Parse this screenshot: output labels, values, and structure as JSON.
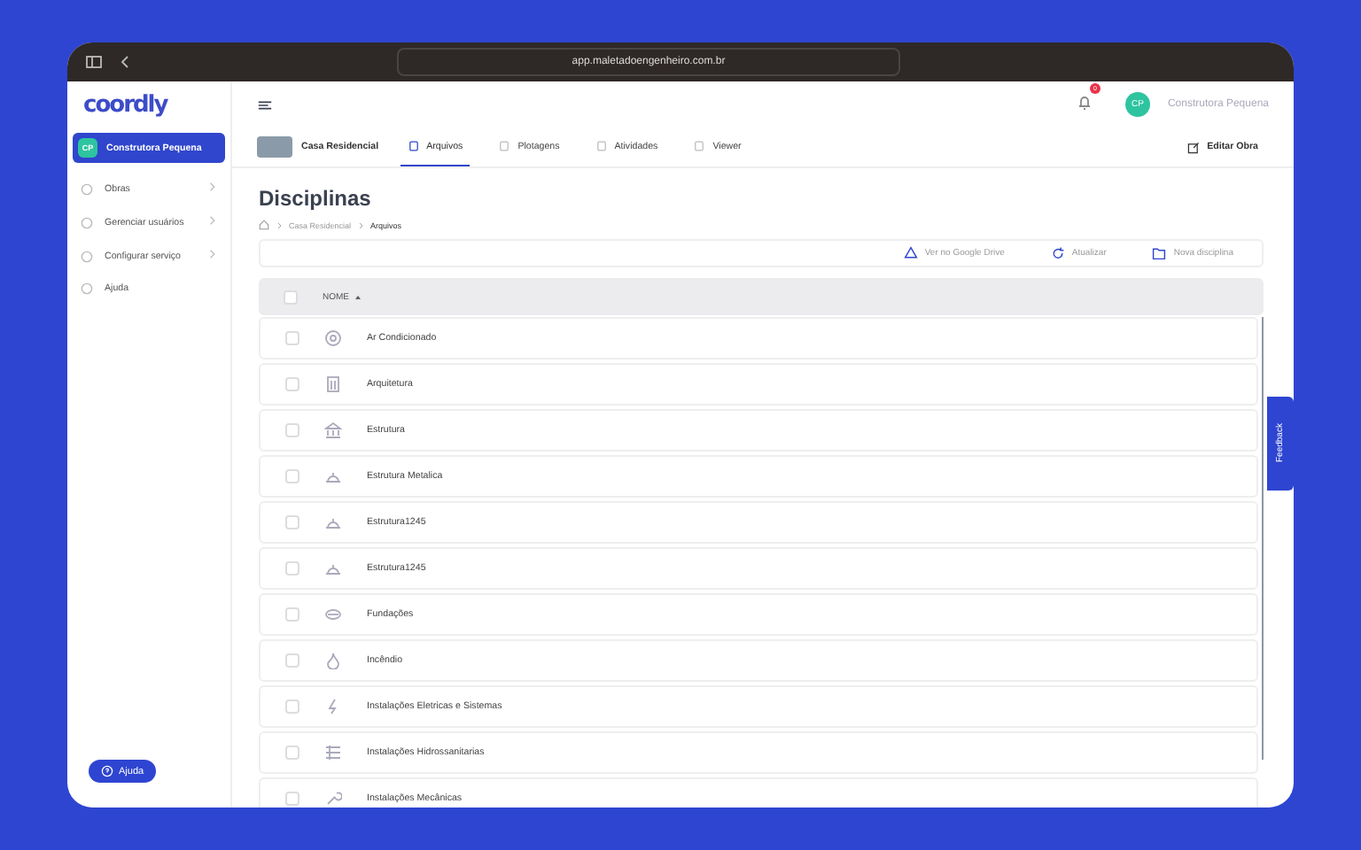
{
  "browser": {
    "url": "app.maletadoengenheiro.com.br"
  },
  "sidebar": {
    "logo": "coordly",
    "company": {
      "initials": "CP",
      "name": "Construtora Pequena",
      "selected": true
    },
    "items": [
      {
        "label": "Obras",
        "expandable": true
      },
      {
        "label": "Gerenciar usuários",
        "expandable": true
      },
      {
        "label": "Configurar serviço",
        "expandable": true
      },
      {
        "label": "Ajuda",
        "expandable": false
      }
    ],
    "help_button": "Ajuda"
  },
  "header": {
    "notification_count": "0",
    "user_initials": "CP",
    "user_name": "Construtora Pequena"
  },
  "project": {
    "name": "Casa Residencial",
    "tabs": [
      {
        "label": "Arquivos",
        "selected": true
      },
      {
        "label": "Plotagens",
        "selected": false
      },
      {
        "label": "Atividades",
        "selected": false
      },
      {
        "label": "Viewer",
        "selected": false
      }
    ],
    "edit": "Editar Obra"
  },
  "page": {
    "title": "Disciplinas",
    "breadcrumb": [
      "Casa Residencial",
      "Arquivos"
    ],
    "actions": [
      "Ver no Google Drive",
      "Atualizar",
      "Nova disciplina"
    ]
  },
  "table": {
    "column": "NOME",
    "all_checked": false,
    "rows": [
      {
        "name": "Ar Condicionado",
        "checked": false
      },
      {
        "name": "Arquitetura",
        "checked": false
      },
      {
        "name": "Estrutura",
        "checked": false
      },
      {
        "name": "Estrutura Metalica",
        "checked": false
      },
      {
        "name": "Estrutura1245",
        "checked": false
      },
      {
        "name": "Estrutura1245",
        "checked": false
      },
      {
        "name": "Fundações",
        "checked": false
      },
      {
        "name": "Incêndio",
        "checked": false
      },
      {
        "name": "Instalações Eletricas e Sistemas",
        "checked": false
      },
      {
        "name": "Instalações Hidrossanitarias",
        "checked": false
      },
      {
        "name": "Instalações Mecânicas",
        "checked": false
      }
    ]
  },
  "feedback": "Feedback"
}
